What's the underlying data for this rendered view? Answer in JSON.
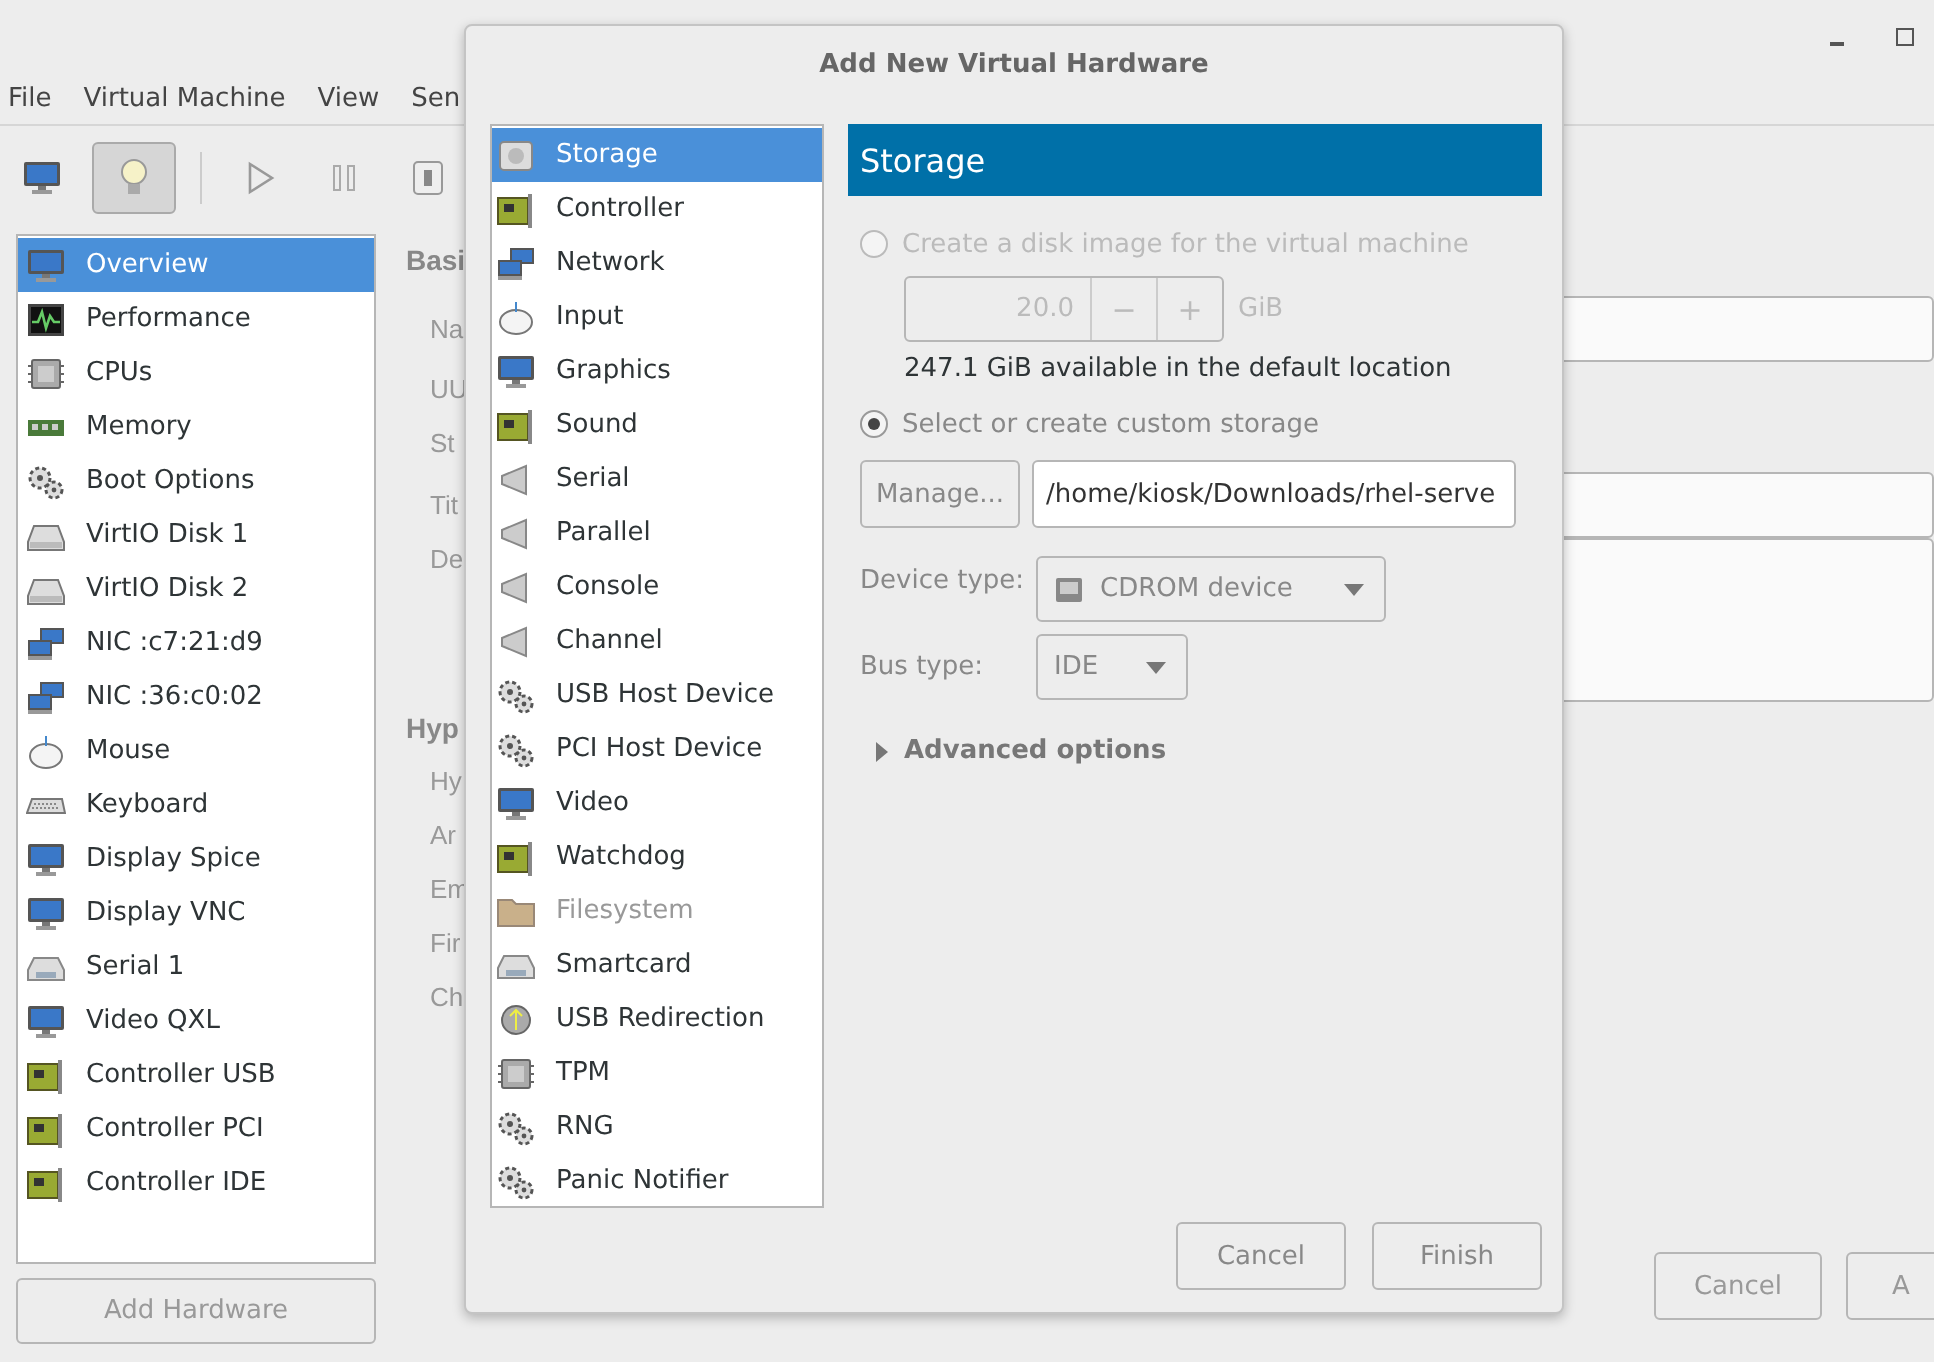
{
  "menu": [
    "File",
    "Virtual Machine",
    "View",
    "Sen"
  ],
  "toolbar": [
    {
      "kind": "monitor",
      "selected": false
    },
    {
      "kind": "bulb",
      "selected": true
    },
    {
      "kind": "play",
      "selected": false
    },
    {
      "kind": "pause",
      "selected": false
    },
    {
      "kind": "power",
      "selected": false
    }
  ],
  "sidebar": {
    "items": [
      {
        "label": "Overview",
        "kind": "monitor",
        "selected": true
      },
      {
        "label": "Performance",
        "kind": "chart",
        "selected": false
      },
      {
        "label": "CPUs",
        "kind": "chip",
        "selected": false
      },
      {
        "label": "Memory",
        "kind": "memory",
        "selected": false
      },
      {
        "label": "Boot Options",
        "kind": "gears",
        "selected": false
      },
      {
        "label": "VirtIO Disk 1",
        "kind": "disk",
        "selected": false
      },
      {
        "label": "VirtIO Disk 2",
        "kind": "disk",
        "selected": false
      },
      {
        "label": "NIC :c7:21:d9",
        "kind": "nic",
        "selected": false
      },
      {
        "label": "NIC :36:c0:02",
        "kind": "nic",
        "selected": false
      },
      {
        "label": "Mouse",
        "kind": "mouse",
        "selected": false
      },
      {
        "label": "Keyboard",
        "kind": "keyboard",
        "selected": false
      },
      {
        "label": "Display Spice",
        "kind": "monitor",
        "selected": false
      },
      {
        "label": "Display VNC",
        "kind": "monitor",
        "selected": false
      },
      {
        "label": "Serial 1",
        "kind": "serial",
        "selected": false
      },
      {
        "label": "Video QXL",
        "kind": "monitor",
        "selected": false
      },
      {
        "label": "Controller USB",
        "kind": "card",
        "selected": false
      },
      {
        "label": "Controller PCI",
        "kind": "card",
        "selected": false
      },
      {
        "label": "Controller IDE",
        "kind": "card",
        "selected": false
      }
    ],
    "add_button": "Add Hardware"
  },
  "details": {
    "sections": [
      {
        "heading": "Basi",
        "rows": [
          {
            "label": "Na",
            "kind": "field"
          },
          {
            "label": "UU",
            "kind": "text"
          },
          {
            "label": "St",
            "kind": "text"
          },
          {
            "label": "Tit",
            "kind": "field"
          },
          {
            "label": "De",
            "kind": "area"
          }
        ]
      },
      {
        "heading": "Hyp",
        "rows": [
          {
            "label": "Hy",
            "kind": "text"
          },
          {
            "label": "Ar",
            "kind": "text"
          },
          {
            "label": "Em",
            "kind": "text"
          },
          {
            "label": "Fir",
            "kind": "text"
          },
          {
            "label": "Ch",
            "kind": "text"
          }
        ]
      }
    ],
    "buttons": [
      "Cancel",
      "A"
    ]
  },
  "dialog": {
    "title": "Add New Virtual Hardware",
    "items": [
      {
        "label": "Storage",
        "kind": "storage",
        "selected": true,
        "disabled": false
      },
      {
        "label": "Controller",
        "kind": "card",
        "selected": false,
        "disabled": false
      },
      {
        "label": "Network",
        "kind": "nic",
        "selected": false,
        "disabled": false
      },
      {
        "label": "Input",
        "kind": "mouse",
        "selected": false,
        "disabled": false
      },
      {
        "label": "Graphics",
        "kind": "monitor",
        "selected": false,
        "disabled": false
      },
      {
        "label": "Sound",
        "kind": "card",
        "selected": false,
        "disabled": false
      },
      {
        "label": "Serial",
        "kind": "plug",
        "selected": false,
        "disabled": false
      },
      {
        "label": "Parallel",
        "kind": "plug",
        "selected": false,
        "disabled": false
      },
      {
        "label": "Console",
        "kind": "plug",
        "selected": false,
        "disabled": false
      },
      {
        "label": "Channel",
        "kind": "plug",
        "selected": false,
        "disabled": false
      },
      {
        "label": "USB Host Device",
        "kind": "gears",
        "selected": false,
        "disabled": false
      },
      {
        "label": "PCI Host Device",
        "kind": "gears",
        "selected": false,
        "disabled": false
      },
      {
        "label": "Video",
        "kind": "monitor",
        "selected": false,
        "disabled": false
      },
      {
        "label": "Watchdog",
        "kind": "card",
        "selected": false,
        "disabled": false
      },
      {
        "label": "Filesystem",
        "kind": "folder",
        "selected": false,
        "disabled": true
      },
      {
        "label": "Smartcard",
        "kind": "serial",
        "selected": false,
        "disabled": false
      },
      {
        "label": "USB Redirection",
        "kind": "round",
        "selected": false,
        "disabled": false
      },
      {
        "label": "TPM",
        "kind": "chip",
        "selected": false,
        "disabled": false
      },
      {
        "label": "RNG",
        "kind": "gears",
        "selected": false,
        "disabled": false
      },
      {
        "label": "Panic Notifier",
        "kind": "gears",
        "selected": false,
        "disabled": false
      }
    ],
    "panel_title": "Storage",
    "options": [
      {
        "label": "Create a disk image for the virtual machine",
        "selected": false,
        "disabled": true
      },
      {
        "label": "Select or create custom storage",
        "selected": true,
        "disabled": false
      }
    ],
    "size": {
      "value": "20.0",
      "minus": "−",
      "plus": "+",
      "unit": "GiB",
      "disabled": true
    },
    "available": "247.1 GiB available in the default location",
    "manage_button": "Manage...",
    "path": "/home/kiosk/Downloads/rhel-serve",
    "device_type": {
      "label": "Device type:",
      "value": "CDROM device"
    },
    "bus_type": {
      "label": "Bus type:",
      "value": "IDE"
    },
    "advanced": {
      "label": "Advanced options",
      "expanded": false
    },
    "buttons": [
      "Cancel",
      "Finish"
    ]
  }
}
